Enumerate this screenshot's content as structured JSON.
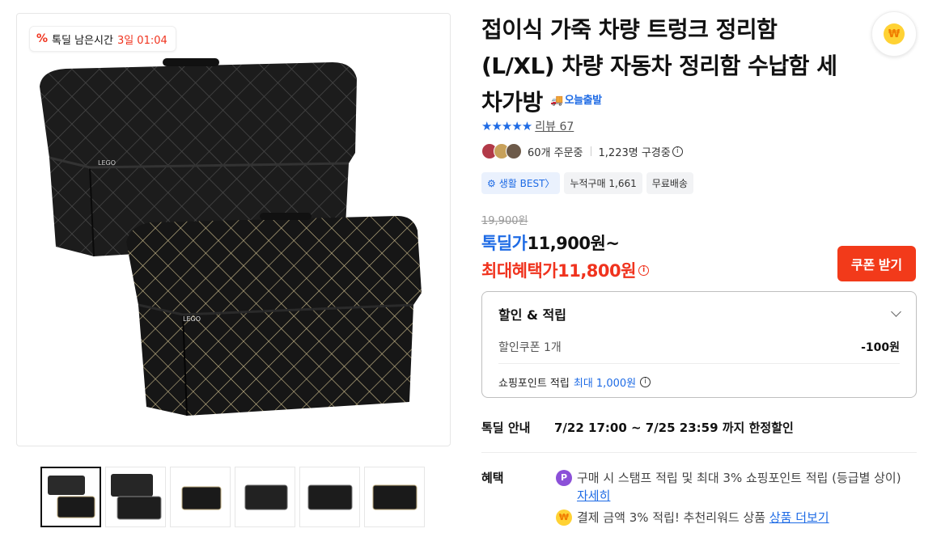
{
  "deal_badge": {
    "icon": "percent-icon",
    "label": "톡딜 남은시간",
    "time": "3일 01:04"
  },
  "product": {
    "title": "접이식 가죽 차량 트렁크 정리함 (L/XL) 차량 자동차 정리함 수납함 세차가방",
    "delivery_badge": "오늘출발"
  },
  "rating": {
    "stars": "★★★★★",
    "review_label": "리뷰",
    "review_count": "67"
  },
  "buyers": {
    "ordering": "60개 주문중",
    "browsing": "1,223명 구경중"
  },
  "tags": [
    {
      "label": "생활 BEST〉",
      "icon": "gear-icon"
    },
    {
      "label": "누적구매 1,661"
    },
    {
      "label": "무료배송"
    }
  ],
  "price": {
    "original": "19,900원",
    "deal_label": "톡딜가",
    "deal_value": "11,900원~",
    "max_label": "최대혜택가",
    "max_value": "11,800원"
  },
  "coupon_button": "쿠폰 받기",
  "discount": {
    "title": "할인 & 적립",
    "coupon_label": "할인쿠폰 1개",
    "coupon_amount": "-100원",
    "points_label": "쇼핑포인트 적립",
    "points_value": "최대 1,000원"
  },
  "notice": {
    "label": "톡딜 안내",
    "value": "7/22 17:00 ~ 7/25 23:59 까지 한정할인"
  },
  "benefit": {
    "label": "혜택",
    "item1_text": "구매 시 스탬프 적립 및 최대 3% 쇼핑포인트 적립 (등급별 상이)",
    "item1_link": "자세히",
    "item2_text": "결제 금액 3% 적립! 추천리워드 상품",
    "item2_link": "상품 더보기"
  },
  "fab": {
    "icon": "coin-icon",
    "glyph": "₩"
  },
  "colors": {
    "accent": "#1e6be5",
    "sale": "#f0331e",
    "coupon": "#f23a1a"
  }
}
